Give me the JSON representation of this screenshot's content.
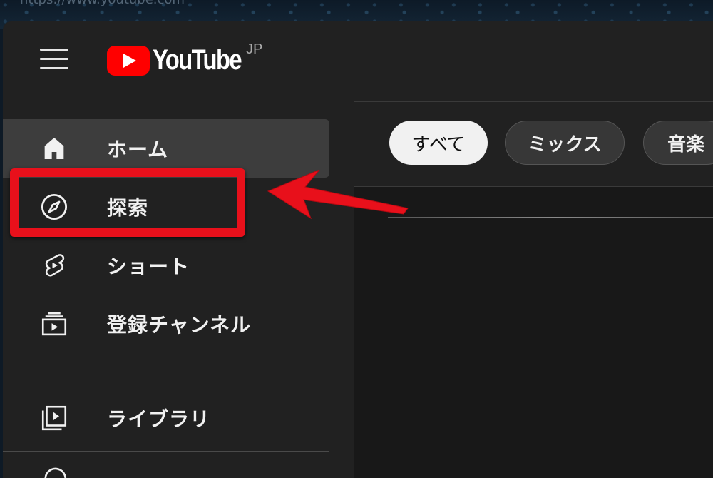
{
  "browser": {
    "url": "https://www.youtube.com"
  },
  "header": {
    "brand": "YouTube",
    "region": "JP"
  },
  "sidebar": {
    "items": [
      {
        "label": "ホーム",
        "icon": "home-icon",
        "active": true
      },
      {
        "label": "探索",
        "icon": "compass-icon",
        "active": false
      },
      {
        "label": "ショート",
        "icon": "shorts-icon",
        "active": false
      },
      {
        "label": "登録チャンネル",
        "icon": "subscriptions-icon",
        "active": false
      }
    ],
    "library": {
      "label": "ライブラリ",
      "icon": "library-icon"
    }
  },
  "chips": [
    {
      "label": "すべて",
      "selected": true
    },
    {
      "label": "ミックス",
      "selected": false
    },
    {
      "label": "音楽",
      "selected": false
    }
  ],
  "colors": {
    "brand_red": "#ff0000",
    "annotation_red": "#e8101b",
    "background": "#212121"
  }
}
